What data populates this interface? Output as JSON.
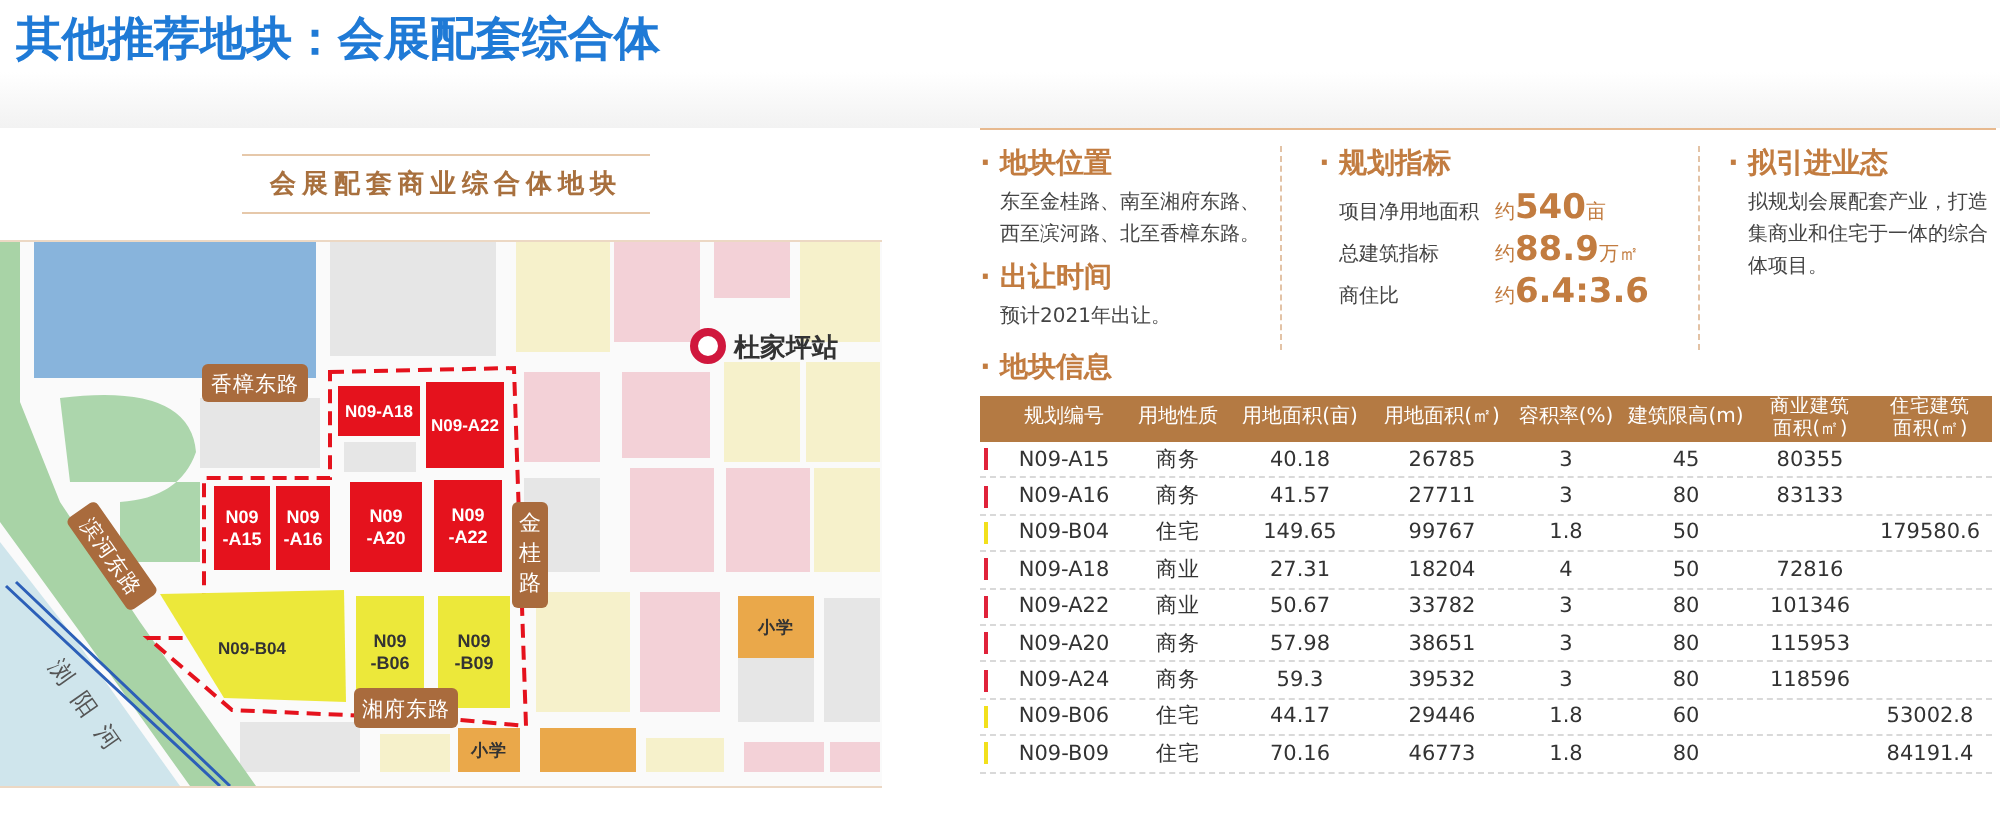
{
  "title": "其他推荐地块：会展配套综合体",
  "map": {
    "title": "会展配套商业综合体地块",
    "station": "杜家坪站",
    "river": "浏阳河",
    "roads": [
      "香樟东路",
      "滨河东路",
      "金桂路",
      "湘府东路"
    ],
    "schools": [
      "小学",
      "小学"
    ],
    "parcels": [
      {
        "kind": "commercial",
        "lines": [
          "N09-A18"
        ]
      },
      {
        "kind": "commercial",
        "lines": [
          "N09-A22"
        ]
      },
      {
        "kind": "commercial",
        "lines": [
          "N09",
          "-A15"
        ]
      },
      {
        "kind": "commercial",
        "lines": [
          "N09",
          "-A16"
        ]
      },
      {
        "kind": "commercial",
        "lines": [
          "N09",
          "-A20"
        ]
      },
      {
        "kind": "commercial",
        "lines": [
          "N09",
          "-A22"
        ]
      },
      {
        "kind": "residential",
        "lines": [
          "N09-B04"
        ]
      },
      {
        "kind": "residential",
        "lines": [
          "N09",
          "-B06"
        ]
      },
      {
        "kind": "residential",
        "lines": [
          "N09",
          "-B09"
        ]
      }
    ]
  },
  "location": {
    "heading": "· 地块位置",
    "text": "东至金桂路、南至湘府东路、西至滨河路、北至香樟东路。"
  },
  "release": {
    "heading": "· 出让时间",
    "text": "预计2021年出让。"
  },
  "indicators": {
    "heading": "· 规划指标",
    "items": [
      {
        "label": "项目净用地面积",
        "prefix": "约",
        "value": "540",
        "unit": "亩"
      },
      {
        "label": "总建筑指标",
        "prefix": "约",
        "value": "88.9",
        "unit": "万㎡"
      },
      {
        "label": "商住比",
        "prefix": "约",
        "value": "6.4:3.6"
      }
    ]
  },
  "business": {
    "heading": "· 拟引进业态",
    "text": "拟规划会展配套产业，打造集商业和住宅于一体的综合体项目。"
  },
  "table": {
    "heading": "· 地块信息",
    "columns": [
      "规划编号",
      "用地性质",
      "用地面积(亩)",
      "用地面积(㎡)",
      "容积率(%)",
      "建筑限高(m)",
      "商业建筑面积(㎡)",
      "住宅建筑面积(㎡)"
    ],
    "rows": [
      {
        "color": "#e0223a",
        "cells": [
          "N09-A15",
          "商务",
          "40.18",
          "26785",
          "3",
          "45",
          "80355",
          ""
        ]
      },
      {
        "color": "#e0223a",
        "cells": [
          "N09-A16",
          "商务",
          "41.57",
          "27711",
          "3",
          "80",
          "83133",
          ""
        ]
      },
      {
        "color": "#f2e01c",
        "cells": [
          "N09-B04",
          "住宅",
          "149.65",
          "99767",
          "1.8",
          "50",
          "",
          "179580.6"
        ]
      },
      {
        "color": "#e0223a",
        "cells": [
          "N09-A18",
          "商业",
          "27.31",
          "18204",
          "4",
          "50",
          "72816",
          ""
        ]
      },
      {
        "color": "#e0223a",
        "cells": [
          "N09-A22",
          "商业",
          "50.67",
          "33782",
          "3",
          "80",
          "101346",
          ""
        ]
      },
      {
        "color": "#e0223a",
        "cells": [
          "N09-A20",
          "商务",
          "57.98",
          "38651",
          "3",
          "80",
          "115953",
          ""
        ]
      },
      {
        "color": "#e0223a",
        "cells": [
          "N09-A24",
          "商务",
          "59.3",
          "39532",
          "3",
          "80",
          "118596",
          ""
        ]
      },
      {
        "color": "#f2e01c",
        "cells": [
          "N09-B06",
          "住宅",
          "44.17",
          "29446",
          "1.8",
          "60",
          "",
          "53002.8"
        ]
      },
      {
        "color": "#f2e01c",
        "cells": [
          "N09-B09",
          "住宅",
          "70.16",
          "46773",
          "1.8",
          "80",
          "",
          "84191.4"
        ]
      }
    ]
  }
}
